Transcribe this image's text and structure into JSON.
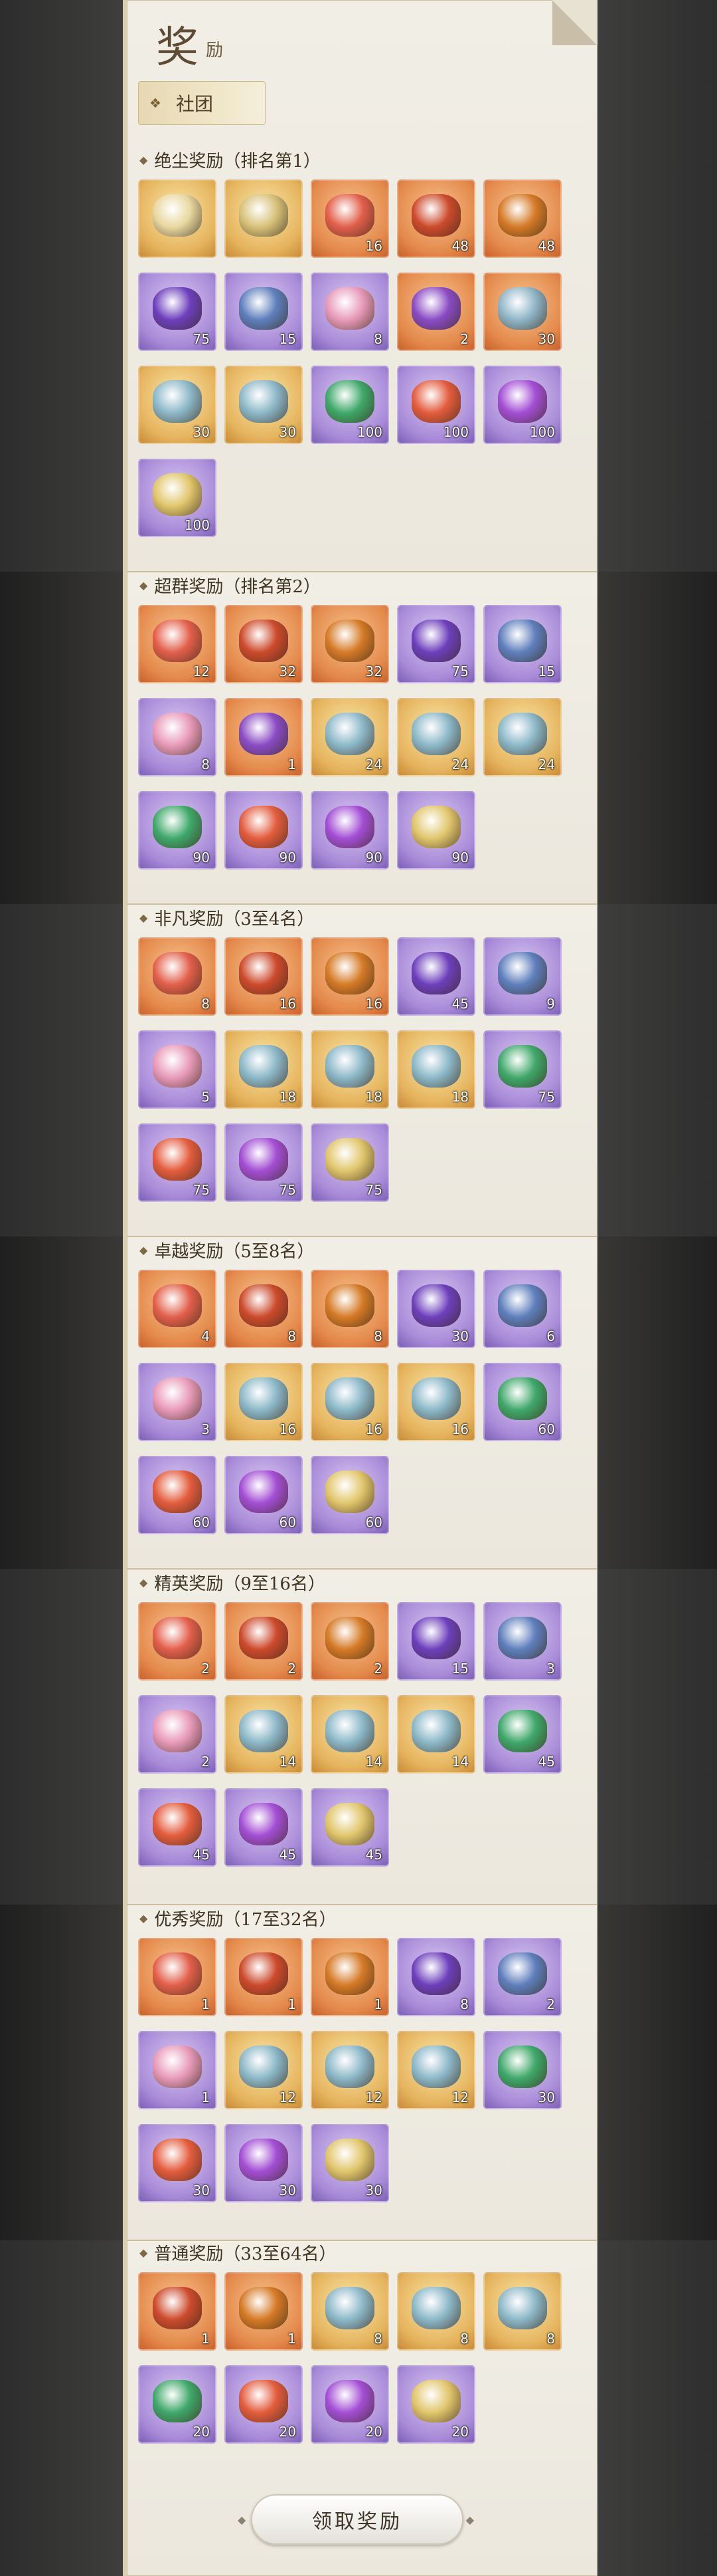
{
  "header": {
    "title": "奖",
    "subtitle": "励"
  },
  "tab": {
    "label": "社团",
    "icon": "flower-icon"
  },
  "sections": [
    {
      "title": "绝尘奖励（排名第1）",
      "items": [
        {
          "bg": "gold",
          "obj": "#e9d8a0",
          "count": ""
        },
        {
          "bg": "gold",
          "obj": "#d8c27a",
          "count": ""
        },
        {
          "bg": "orange",
          "obj": "#e25f4a",
          "count": "16"
        },
        {
          "bg": "orange",
          "obj": "#cc4a2c",
          "count": "48"
        },
        {
          "bg": "orange",
          "obj": "#d57a26",
          "count": "48"
        },
        {
          "bg": "purple",
          "obj": "#6d3fbc",
          "count": "75"
        },
        {
          "bg": "purple",
          "obj": "#5e7fbc",
          "count": "15"
        },
        {
          "bg": "purple",
          "obj": "#e89ab9",
          "count": "8"
        },
        {
          "bg": "orange",
          "obj": "#8a4bc4",
          "count": "2"
        },
        {
          "bg": "orange",
          "obj": "#8fb5c7",
          "count": "30"
        },
        {
          "bg": "gold",
          "obj": "#8cb8c8",
          "count": "30"
        },
        {
          "bg": "gold",
          "obj": "#8cb8c8",
          "count": "30"
        },
        {
          "bg": "purple",
          "obj": "#3fa86a",
          "count": "100"
        },
        {
          "bg": "purple",
          "obj": "#e35c3d",
          "count": "100"
        },
        {
          "bg": "purple",
          "obj": "#a34ed4",
          "count": "100"
        },
        {
          "bg": "purple",
          "obj": "#e1c66c",
          "count": "100"
        }
      ]
    },
    {
      "title": "超群奖励（排名第2）",
      "items": [
        {
          "bg": "orange",
          "obj": "#e25f4a",
          "count": "12"
        },
        {
          "bg": "orange",
          "obj": "#cc4a2c",
          "count": "32"
        },
        {
          "bg": "orange",
          "obj": "#d57a26",
          "count": "32"
        },
        {
          "bg": "purple",
          "obj": "#6d3fbc",
          "count": "75"
        },
        {
          "bg": "purple",
          "obj": "#5e7fbc",
          "count": "15"
        },
        {
          "bg": "purple",
          "obj": "#e89ab9",
          "count": "8"
        },
        {
          "bg": "orange",
          "obj": "#8a4bc4",
          "count": "1"
        },
        {
          "bg": "gold",
          "obj": "#8cb8c8",
          "count": "24"
        },
        {
          "bg": "gold",
          "obj": "#8cb8c8",
          "count": "24"
        },
        {
          "bg": "gold",
          "obj": "#8cb8c8",
          "count": "24"
        },
        {
          "bg": "purple",
          "obj": "#3fa86a",
          "count": "90"
        },
        {
          "bg": "purple",
          "obj": "#e35c3d",
          "count": "90"
        },
        {
          "bg": "purple",
          "obj": "#a34ed4",
          "count": "90"
        },
        {
          "bg": "purple",
          "obj": "#e1c66c",
          "count": "90"
        }
      ]
    },
    {
      "title": "非凡奖励（3至4名）",
      "items": [
        {
          "bg": "orange",
          "obj": "#e25f4a",
          "count": "8"
        },
        {
          "bg": "orange",
          "obj": "#cc4a2c",
          "count": "16"
        },
        {
          "bg": "orange",
          "obj": "#d57a26",
          "count": "16"
        },
        {
          "bg": "purple",
          "obj": "#6d3fbc",
          "count": "45"
        },
        {
          "bg": "purple",
          "obj": "#5e7fbc",
          "count": "9"
        },
        {
          "bg": "purple",
          "obj": "#e89ab9",
          "count": "5"
        },
        {
          "bg": "gold",
          "obj": "#8cb8c8",
          "count": "18"
        },
        {
          "bg": "gold",
          "obj": "#8cb8c8",
          "count": "18"
        },
        {
          "bg": "gold",
          "obj": "#8cb8c8",
          "count": "18"
        },
        {
          "bg": "purple",
          "obj": "#3fa86a",
          "count": "75"
        },
        {
          "bg": "purple",
          "obj": "#e35c3d",
          "count": "75"
        },
        {
          "bg": "purple",
          "obj": "#a34ed4",
          "count": "75"
        },
        {
          "bg": "purple",
          "obj": "#e1c66c",
          "count": "75"
        }
      ]
    },
    {
      "title": "卓越奖励（5至8名）",
      "items": [
        {
          "bg": "orange",
          "obj": "#e25f4a",
          "count": "4"
        },
        {
          "bg": "orange",
          "obj": "#cc4a2c",
          "count": "8"
        },
        {
          "bg": "orange",
          "obj": "#d57a26",
          "count": "8"
        },
        {
          "bg": "purple",
          "obj": "#6d3fbc",
          "count": "30"
        },
        {
          "bg": "purple",
          "obj": "#5e7fbc",
          "count": "6"
        },
        {
          "bg": "purple",
          "obj": "#e89ab9",
          "count": "3"
        },
        {
          "bg": "gold",
          "obj": "#8cb8c8",
          "count": "16"
        },
        {
          "bg": "gold",
          "obj": "#8cb8c8",
          "count": "16"
        },
        {
          "bg": "gold",
          "obj": "#8cb8c8",
          "count": "16"
        },
        {
          "bg": "purple",
          "obj": "#3fa86a",
          "count": "60"
        },
        {
          "bg": "purple",
          "obj": "#e35c3d",
          "count": "60"
        },
        {
          "bg": "purple",
          "obj": "#a34ed4",
          "count": "60"
        },
        {
          "bg": "purple",
          "obj": "#e1c66c",
          "count": "60"
        }
      ]
    },
    {
      "title": "精英奖励（9至16名）",
      "items": [
        {
          "bg": "orange",
          "obj": "#e25f4a",
          "count": "2"
        },
        {
          "bg": "orange",
          "obj": "#cc4a2c",
          "count": "2"
        },
        {
          "bg": "orange",
          "obj": "#d57a26",
          "count": "2"
        },
        {
          "bg": "purple",
          "obj": "#6d3fbc",
          "count": "15"
        },
        {
          "bg": "purple",
          "obj": "#5e7fbc",
          "count": "3"
        },
        {
          "bg": "purple",
          "obj": "#e89ab9",
          "count": "2"
        },
        {
          "bg": "gold",
          "obj": "#8cb8c8",
          "count": "14"
        },
        {
          "bg": "gold",
          "obj": "#8cb8c8",
          "count": "14"
        },
        {
          "bg": "gold",
          "obj": "#8cb8c8",
          "count": "14"
        },
        {
          "bg": "purple",
          "obj": "#3fa86a",
          "count": "45"
        },
        {
          "bg": "purple",
          "obj": "#e35c3d",
          "count": "45"
        },
        {
          "bg": "purple",
          "obj": "#a34ed4",
          "count": "45"
        },
        {
          "bg": "purple",
          "obj": "#e1c66c",
          "count": "45"
        }
      ]
    },
    {
      "title": "优秀奖励（17至32名）",
      "items": [
        {
          "bg": "orange",
          "obj": "#e25f4a",
          "count": "1"
        },
        {
          "bg": "orange",
          "obj": "#cc4a2c",
          "count": "1"
        },
        {
          "bg": "orange",
          "obj": "#d57a26",
          "count": "1"
        },
        {
          "bg": "purple",
          "obj": "#6d3fbc",
          "count": "8"
        },
        {
          "bg": "purple",
          "obj": "#5e7fbc",
          "count": "2"
        },
        {
          "bg": "purple",
          "obj": "#e89ab9",
          "count": "1"
        },
        {
          "bg": "gold",
          "obj": "#8cb8c8",
          "count": "12"
        },
        {
          "bg": "gold",
          "obj": "#8cb8c8",
          "count": "12"
        },
        {
          "bg": "gold",
          "obj": "#8cb8c8",
          "count": "12"
        },
        {
          "bg": "purple",
          "obj": "#3fa86a",
          "count": "30"
        },
        {
          "bg": "purple",
          "obj": "#e35c3d",
          "count": "30"
        },
        {
          "bg": "purple",
          "obj": "#a34ed4",
          "count": "30"
        },
        {
          "bg": "purple",
          "obj": "#e1c66c",
          "count": "30"
        }
      ]
    },
    {
      "title": "普通奖励（33至64名）",
      "items": [
        {
          "bg": "orange",
          "obj": "#cc4a2c",
          "count": "1"
        },
        {
          "bg": "orange",
          "obj": "#d57a26",
          "count": "1"
        },
        {
          "bg": "gold",
          "obj": "#8cb8c8",
          "count": "8"
        },
        {
          "bg": "gold",
          "obj": "#8cb8c8",
          "count": "8"
        },
        {
          "bg": "gold",
          "obj": "#8cb8c8",
          "count": "8"
        },
        {
          "bg": "purple",
          "obj": "#3fa86a",
          "count": "20"
        },
        {
          "bg": "purple",
          "obj": "#e35c3d",
          "count": "20"
        },
        {
          "bg": "purple",
          "obj": "#a34ed4",
          "count": "20"
        },
        {
          "bg": "purple",
          "obj": "#e1c66c",
          "count": "20"
        }
      ]
    }
  ],
  "claim_button": {
    "label": "领取奖励"
  }
}
